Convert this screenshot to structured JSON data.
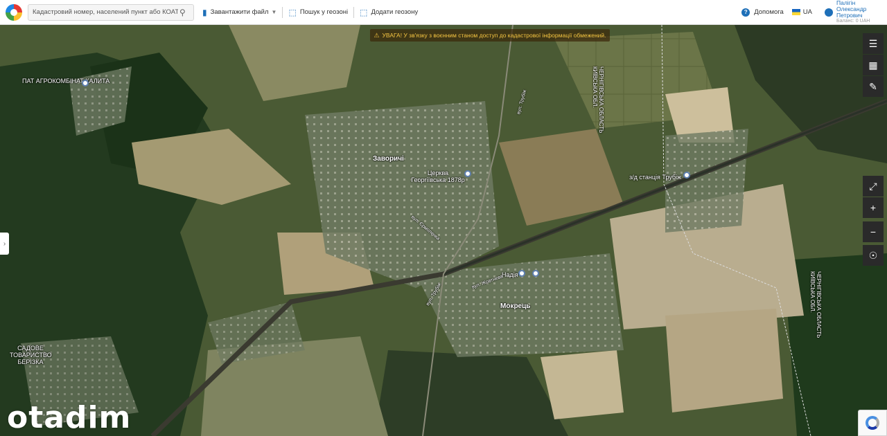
{
  "toolbar": {
    "search_placeholder": "Кадастровий номер, населений пункт або КОАТУУ",
    "upload_label": "Завантажити файл",
    "geosearch_label": "Пошук у геозоні",
    "add_geozone_label": "Додати геозону",
    "help_label": "Допомога",
    "lang_label": "UA",
    "user_name": "Палігін Олександр Петрович",
    "balance_label": "Баланс: 0 UAH"
  },
  "warning": "УВАГА! У зв'язку з воєнним станом доступ до кадастрової інформації обмежений.",
  "map": {
    "places": [
      {
        "name": "ПАТ АГРОКОМБІНАТ КАЛИТА",
        "kind": "poi"
      },
      {
        "name": "Заворичі",
        "kind": "village"
      },
      {
        "name": "Церква Георгіївська 1878р",
        "kind": "poi"
      },
      {
        "name": "з/д станція Трубіж",
        "kind": "poi"
      },
      {
        "name": "Надія",
        "kind": "poi"
      },
      {
        "name": "Мокрець",
        "kind": "village"
      },
      {
        "name": "САДОВЕ ТОВАРИСТВО БЕРІЗКА",
        "kind": "poi"
      },
      {
        "name": "ЧЕРНІГІВСЬКА ОБЛАСТЬ КИЇВСЬКА ОБЛ.",
        "kind": "border"
      },
      {
        "name": "ЧЕРНІГІВСЬКА ОБЛАСТЬ КИЇВСЬКА ОБЛ.",
        "kind": "border"
      }
    ],
    "road_labels": [
      "вул. Трубіж",
      "вул. Єрмоленка",
      "вул. Трубіж",
      "вул. Жовтнева"
    ]
  },
  "tools": {
    "layers": "layers-icon",
    "cadastre": "cadastre-map-icon",
    "ruler": "ruler-icon",
    "fullscreen": "fullscreen-icon",
    "zoom_in": "zoom-in-icon",
    "zoom_out": "zoom-out-icon",
    "locate": "locate-icon"
  },
  "watermark": "otadim",
  "colors": {
    "brand": "#1e6fb8",
    "warning_text": "#f5c542"
  }
}
